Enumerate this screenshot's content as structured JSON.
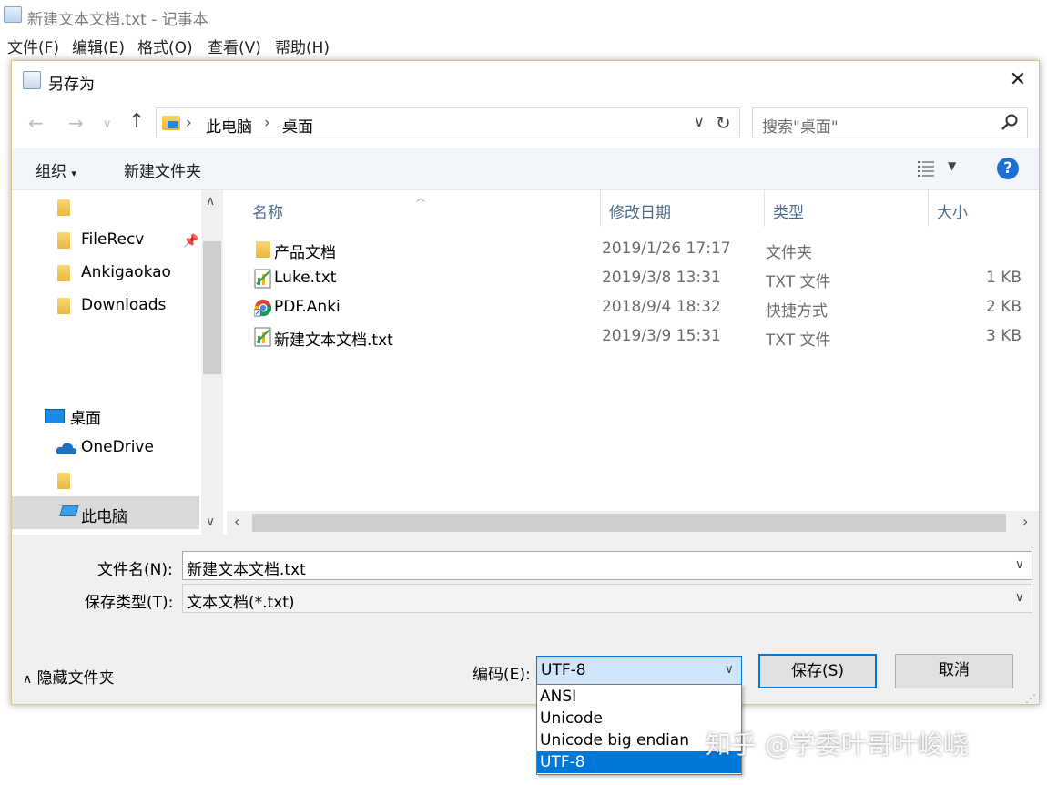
{
  "notepad": {
    "title": "新建文本文档.txt - 记事本",
    "menu": [
      "文件(F)",
      "编辑(E)",
      "格式(O)",
      "查看(V)",
      "帮助(H)"
    ]
  },
  "dialog": {
    "title": "另存为",
    "address": {
      "crumbs": [
        "此电脑",
        "桌面"
      ]
    },
    "search_placeholder": "搜索\"桌面\"",
    "toolbar": {
      "organize": "组织",
      "new_folder": "新建文件夹"
    },
    "nav": {
      "items": [
        "FileRecv",
        "Ankigaokao",
        "Downloads",
        "桌面",
        "OneDrive",
        "此电脑"
      ]
    },
    "columns": [
      "名称",
      "修改日期",
      "类型",
      "大小"
    ],
    "files": [
      {
        "name": "产品文档",
        "date": "2019/1/26 17:17",
        "type": "文件夹",
        "size": "",
        "icon": "folder-icon"
      },
      {
        "name": "Luke.txt",
        "date": "2019/3/8 13:31",
        "type": "TXT 文件",
        "size": "1 KB",
        "icon": "text-file-icon"
      },
      {
        "name": "PDF.Anki",
        "date": "2018/9/4 18:32",
        "type": "快捷方式",
        "size": "2 KB",
        "icon": "chrome-shortcut-icon"
      },
      {
        "name": "新建文本文档.txt",
        "date": "2019/3/9 15:31",
        "type": "TXT 文件",
        "size": "3 KB",
        "icon": "text-file-icon"
      }
    ],
    "filename_label": "文件名(N):",
    "filename_value": "新建文本文档.txt",
    "filetype_label": "保存类型(T):",
    "filetype_value": "文本文档(*.txt)",
    "hide_folders": "隐藏文件夹",
    "encoding_label": "编码(E):",
    "encoding_value": "UTF-8",
    "encoding_options": [
      "ANSI",
      "Unicode",
      "Unicode big endian",
      "UTF-8"
    ],
    "encoding_selected_index": 3,
    "save_button": "保存(S)",
    "cancel_button": "取消"
  },
  "watermark": "知乎 @学委叶哥叶峻峣",
  "colors": {
    "accent": "#0078d7",
    "toolbar_bg": "#f2f6fb",
    "selection": "#d9d9d9"
  }
}
